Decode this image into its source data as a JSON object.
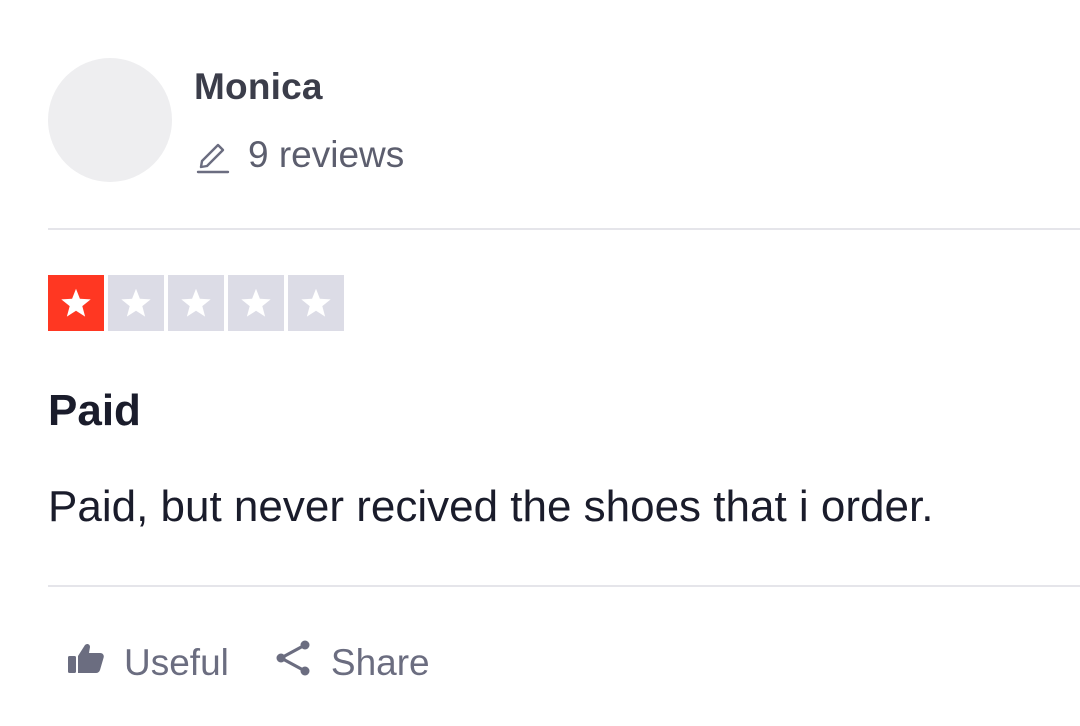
{
  "consumer": {
    "name": "Monica",
    "review_count": "9 reviews",
    "icons": {
      "reviews": "pencil-icon"
    }
  },
  "rating": {
    "stars_filled": 1,
    "stars_total": 5,
    "colors": {
      "filled": "#ff3722",
      "empty": "#dcdce6",
      "star": "#ffffff"
    }
  },
  "review": {
    "title": "Paid",
    "body": "Paid, but never recived the shoes that i order."
  },
  "actions": {
    "useful_label": "Useful",
    "share_label": "Share",
    "icons": {
      "useful": "thumbs-up-icon",
      "share": "share-icon"
    }
  }
}
